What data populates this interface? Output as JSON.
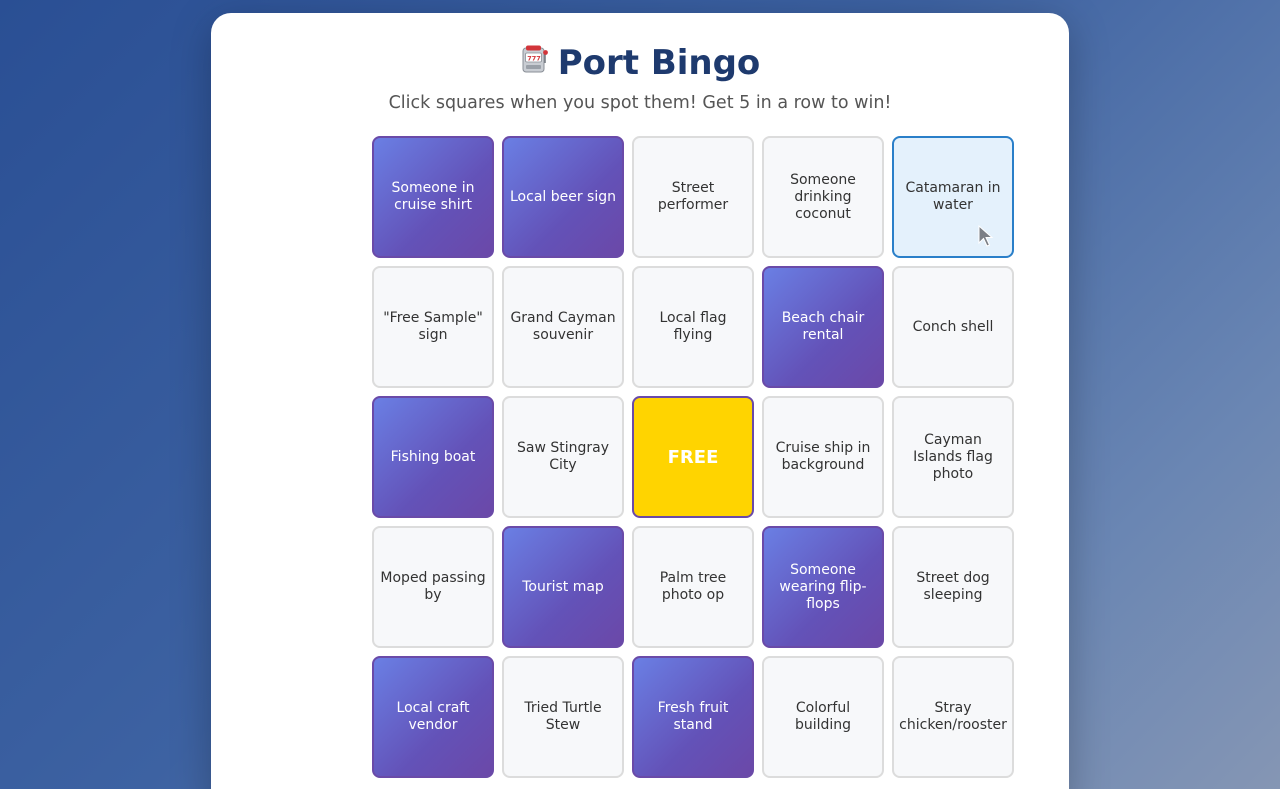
{
  "header": {
    "title_icon": "slot-machine-icon",
    "title": "Port Bingo",
    "subtitle": "Click squares when you spot them! Get 5 in a row to win!"
  },
  "board": {
    "cells": [
      {
        "label": "Someone in cruise shirt",
        "state": "marked"
      },
      {
        "label": "Local beer sign",
        "state": "marked"
      },
      {
        "label": "Street performer",
        "state": "unmarked"
      },
      {
        "label": "Someone drinking coconut",
        "state": "unmarked"
      },
      {
        "label": "Catamaran in water",
        "state": "hover"
      },
      {
        "label": "\"Free Sample\" sign",
        "state": "unmarked"
      },
      {
        "label": "Grand Cayman souvenir",
        "state": "unmarked"
      },
      {
        "label": "Local flag flying",
        "state": "unmarked"
      },
      {
        "label": "Beach chair rental",
        "state": "marked"
      },
      {
        "label": "Conch shell",
        "state": "unmarked"
      },
      {
        "label": "Fishing boat",
        "state": "marked"
      },
      {
        "label": "Saw Stingray City",
        "state": "unmarked"
      },
      {
        "label": "FREE",
        "state": "free"
      },
      {
        "label": "Cruise ship in background",
        "state": "unmarked"
      },
      {
        "label": "Cayman Islands flag photo",
        "state": "unmarked"
      },
      {
        "label": "Moped passing by",
        "state": "unmarked"
      },
      {
        "label": "Tourist map",
        "state": "marked"
      },
      {
        "label": "Palm tree photo op",
        "state": "unmarked"
      },
      {
        "label": "Someone wearing flip-flops",
        "state": "marked"
      },
      {
        "label": "Street dog sleeping",
        "state": "unmarked"
      },
      {
        "label": "Local craft vendor",
        "state": "marked"
      },
      {
        "label": "Tried Turtle Stew",
        "state": "unmarked"
      },
      {
        "label": "Fresh fruit stand",
        "state": "marked"
      },
      {
        "label": "Colorful building",
        "state": "unmarked"
      },
      {
        "label": "Stray chicken/rooster",
        "state": "unmarked"
      }
    ]
  },
  "colors": {
    "title": "#1e3a6e",
    "marked_gradient_start": "#6a7fe4",
    "marked_gradient_end": "#6b48a8",
    "free": "#ffd400",
    "hover_background": "#e4f1fc",
    "hover_border": "#2a7fc9"
  }
}
